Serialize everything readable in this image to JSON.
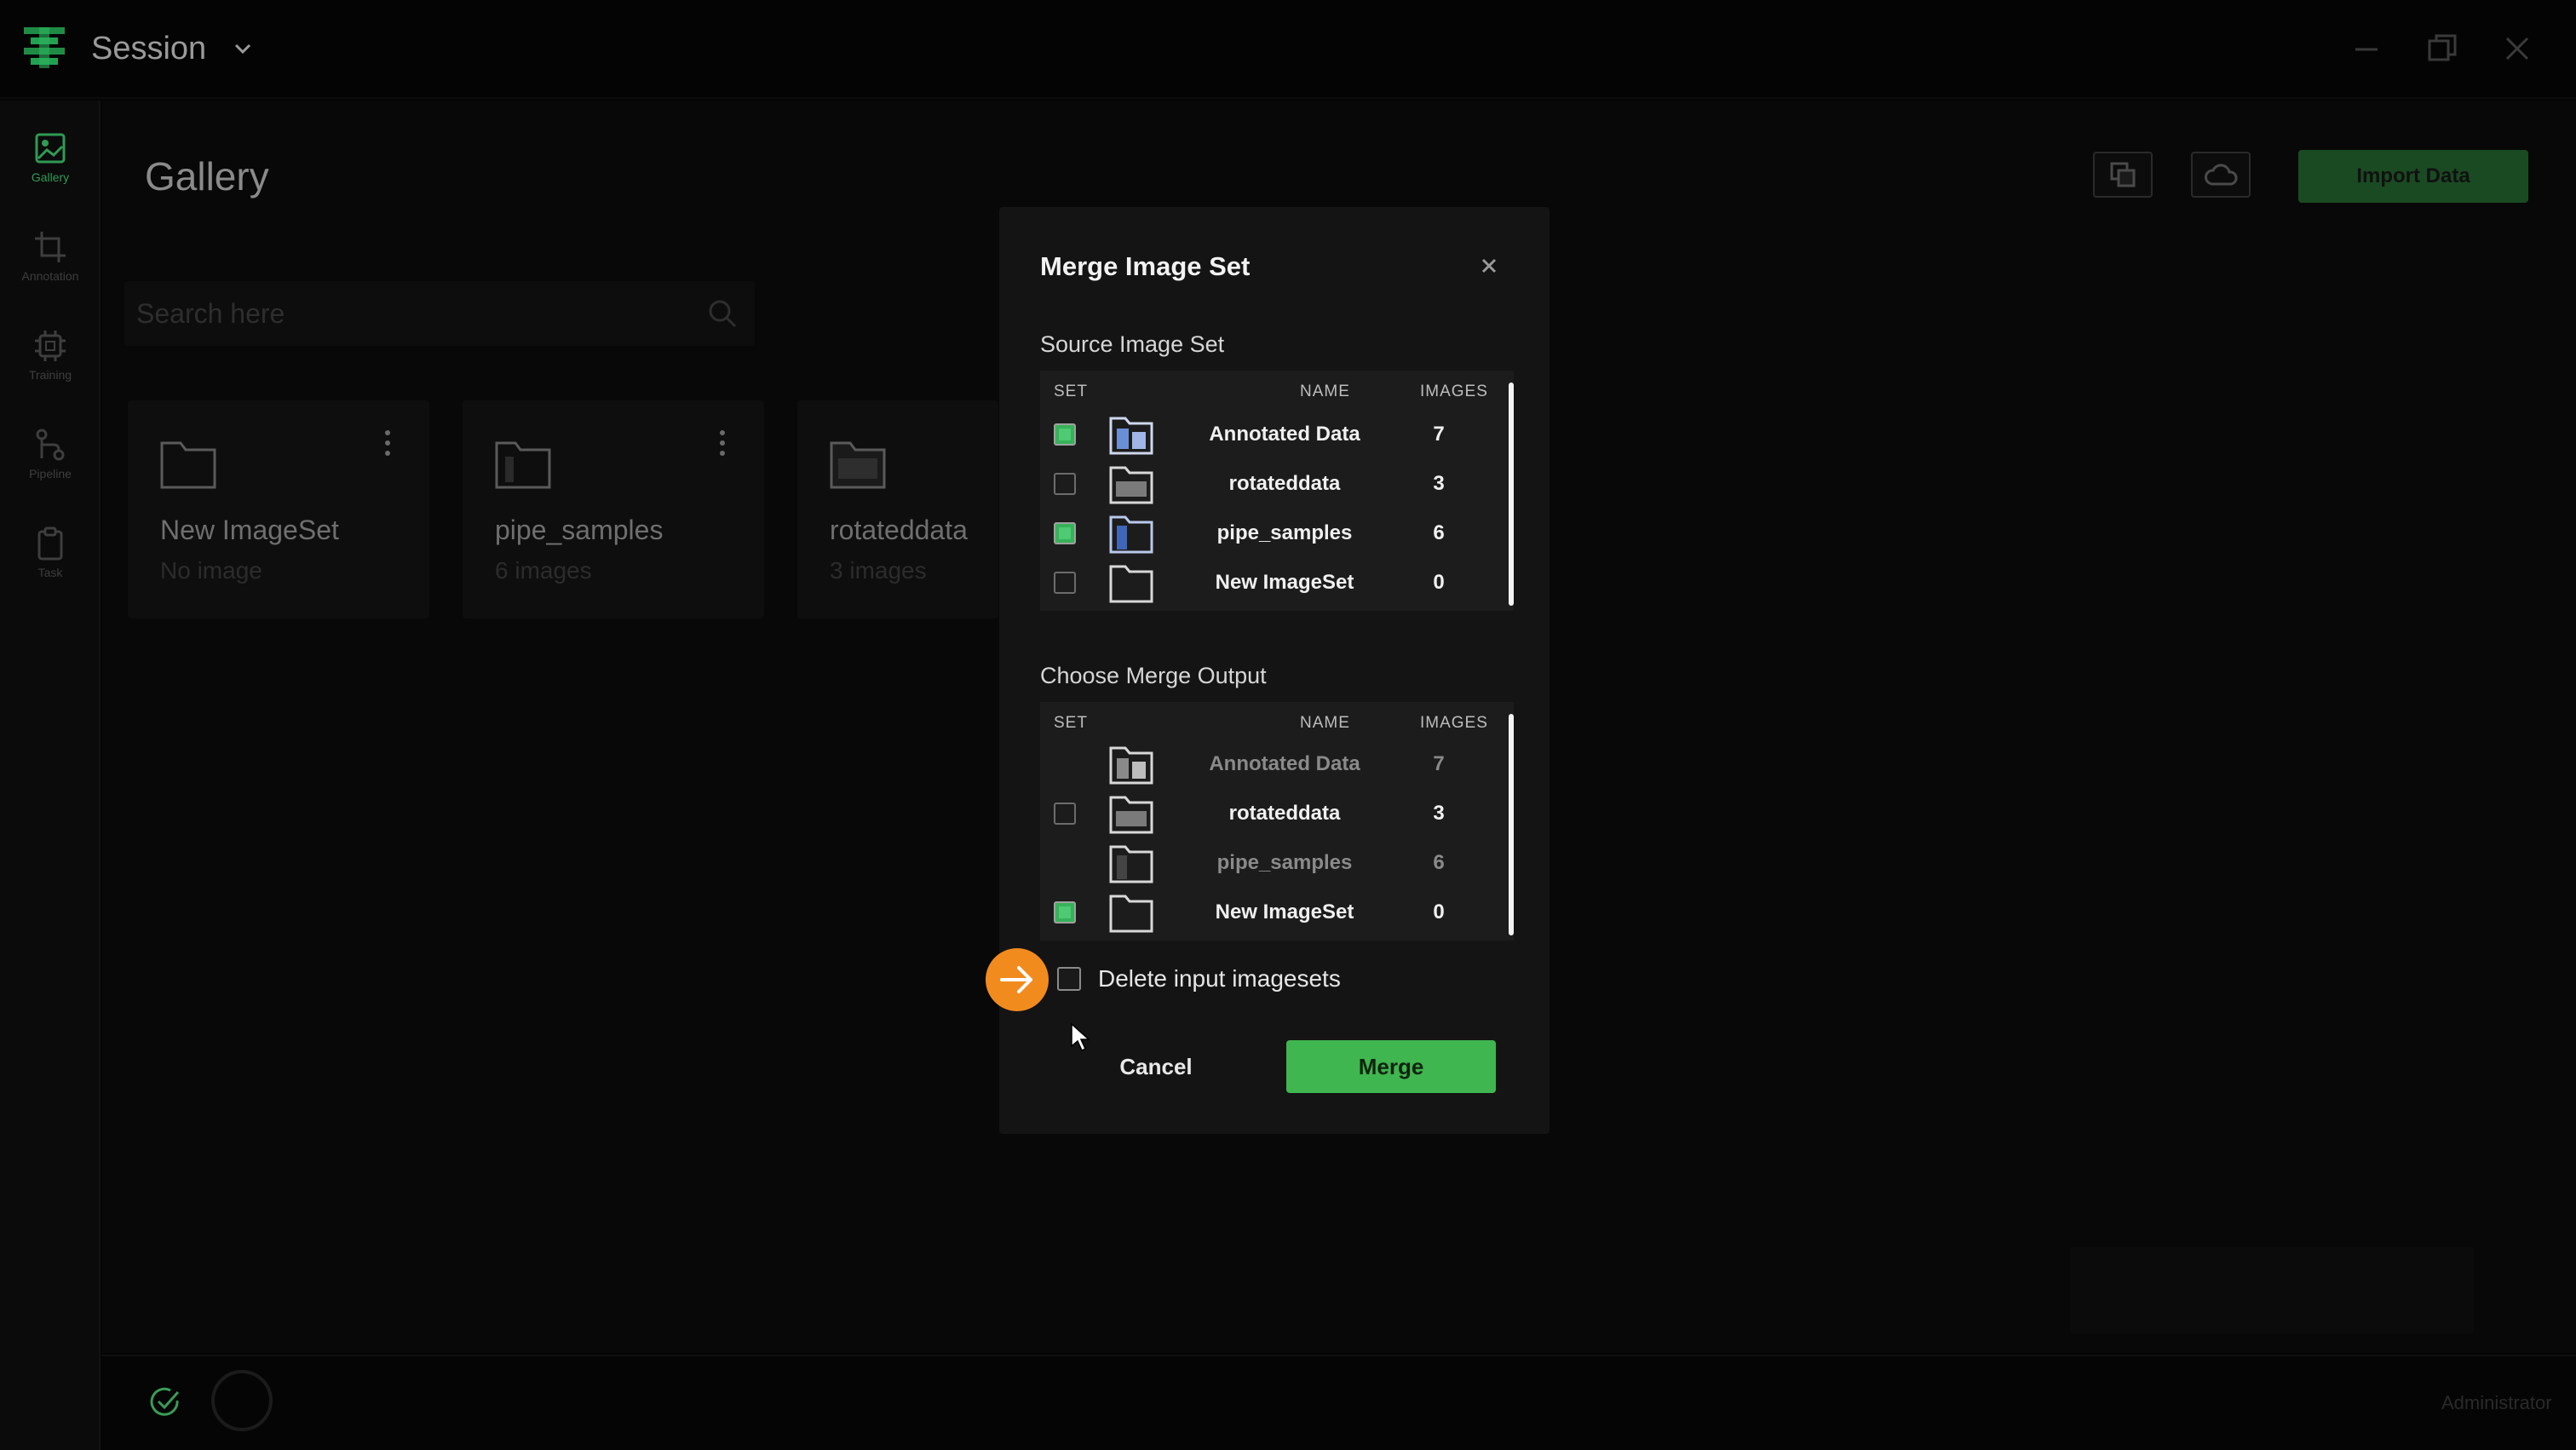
{
  "titlebar": {
    "session": "Session",
    "logo_icon": "stack-logo-icon"
  },
  "sidebar": {
    "items": [
      {
        "label": "Gallery",
        "icon": "image-icon"
      },
      {
        "label": "Annotation",
        "icon": "crop-icon"
      },
      {
        "label": "Training",
        "icon": "chip-icon"
      },
      {
        "label": "Pipeline",
        "icon": "pipeline-icon"
      },
      {
        "label": "Task",
        "icon": "clipboard-icon"
      }
    ]
  },
  "main": {
    "title": "Gallery",
    "import_label": "Import Data",
    "search_placeholder": "Search here",
    "cards": [
      {
        "name": "New ImageSet",
        "count": "No image"
      },
      {
        "name": "pipe_samples",
        "count": "6 images"
      },
      {
        "name": "rotateddata",
        "count": "3 images"
      }
    ]
  },
  "status": {
    "user": "Administrator"
  },
  "modal": {
    "title": "Merge Image Set",
    "source_label": "Source Image Set",
    "output_label": "Choose Merge Output",
    "headers": {
      "set": "SET",
      "name": "NAME",
      "images": "IMAGES"
    },
    "source_rows": [
      {
        "name": "Annotated Data",
        "images": "7",
        "checked": true
      },
      {
        "name": "rotateddata",
        "images": "3",
        "checked": false
      },
      {
        "name": "pipe_samples",
        "images": "6",
        "checked": true
      },
      {
        "name": "New ImageSet",
        "images": "0",
        "checked": false
      }
    ],
    "output_rows": [
      {
        "name": "Annotated Data",
        "images": "7",
        "checked": false,
        "disabled": true
      },
      {
        "name": "rotateddata",
        "images": "3",
        "checked": false,
        "disabled": false
      },
      {
        "name": "pipe_samples",
        "images": "6",
        "checked": false,
        "disabled": true
      },
      {
        "name": "New ImageSet",
        "images": "0",
        "checked": true,
        "disabled": false
      }
    ],
    "delete_label": "Delete input imagesets",
    "cancel_label": "Cancel",
    "merge_label": "Merge"
  },
  "colors": {
    "accent_green": "#3fb64f",
    "highlight_orange": "#f28b1e",
    "background": "#050505"
  }
}
